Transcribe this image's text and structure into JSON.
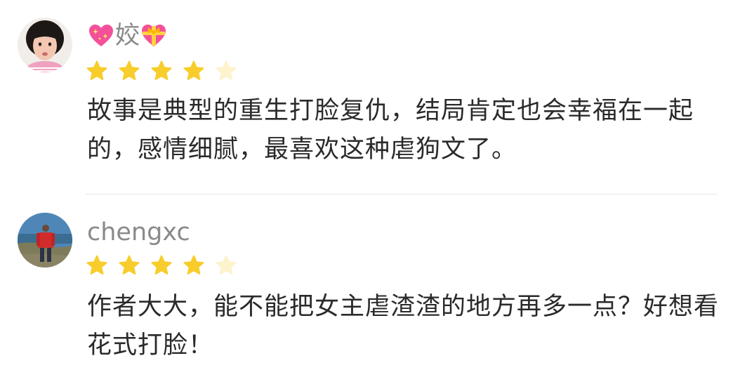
{
  "reviews": [
    {
      "username": "姣",
      "rating": 4,
      "max_rating": 5,
      "comment_lines": [
        "故事是典型的重生打脸复仇，结局肯定也会幸福在一起",
        "的，感情细腻，最喜欢这种虐狗文了。"
      ]
    },
    {
      "username": "chengxc",
      "rating": 4,
      "max_rating": 5,
      "comment_lines": [
        "作者大大，能不能把女主虐渣渣的地方再多一点？好想看",
        "花式打脸！"
      ]
    }
  ],
  "icons": {
    "leading_username_emoji": "sparkling-heart",
    "trailing_username_emoji": "heart-with-ribbon",
    "star": "star"
  },
  "colors": {
    "star_filled": "#f8cd2b",
    "star_empty": "#fdf3cc",
    "username": "#8a8a8a",
    "comment_text": "#2a2a2a",
    "divider": "#e8e8e8"
  }
}
